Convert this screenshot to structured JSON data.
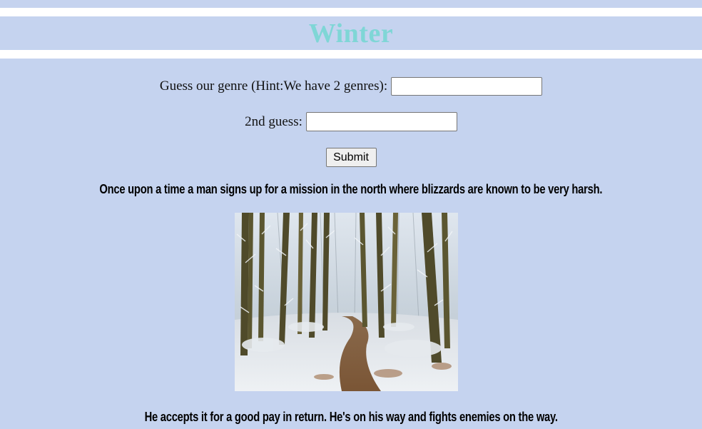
{
  "page": {
    "title": "Winter"
  },
  "form": {
    "genre_label": "Guess our genre (Hint:We have 2 genres):",
    "genre_value": "",
    "second_label": "2nd guess:",
    "second_value": "",
    "submit_label": "Submit"
  },
  "story": {
    "paragraph_1": "Once upon a time a man signs up for a mission in the north where blizzards are known to be very harsh.",
    "paragraph_2": "He accepts it for a good pay in return. He's on his way and fights enemies on the way."
  },
  "image": {
    "subject": "snowy-forest-path"
  },
  "colors": {
    "background": "#c5d3ef",
    "title": "#7fd6d6",
    "divider": "#ffffff"
  }
}
